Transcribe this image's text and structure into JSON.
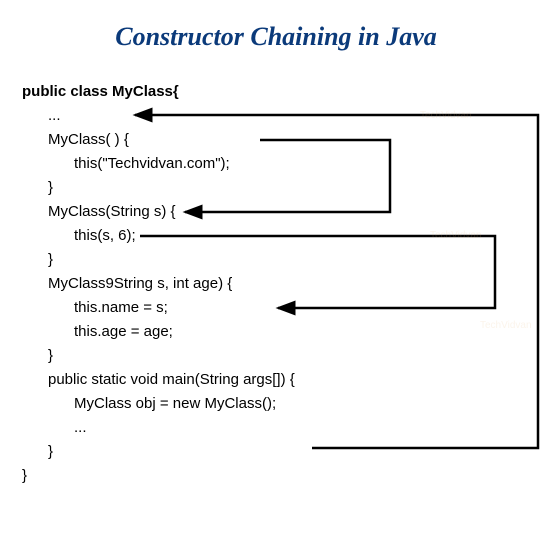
{
  "title": "Constructor Chaining in Java",
  "code": {
    "l1": "public class MyClass{",
    "l2": "...",
    "l3": "MyClass( ) {",
    "l4": "this(\"Techvidvan.com\");",
    "l5": "",
    "l6": "}",
    "l7": "MyClass(String s) {",
    "l8": "this(s, 6);",
    "l9": "",
    "l10": "}",
    "l11": "MyClass9String s, int age) {",
    "l12": "this.name = s;",
    "l13": "this.age = age;",
    "l14": "}",
    "l15": "public static void main(String args[]) {",
    "l16": "MyClass obj = new MyClass();",
    "l17": "...",
    "l18": "}",
    "l19": "}"
  },
  "arrows": {
    "stroke": "#000000",
    "strokeWidth": 2.5
  }
}
